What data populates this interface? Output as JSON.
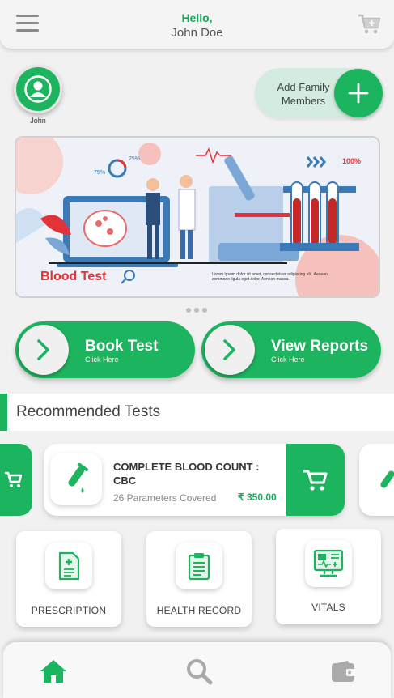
{
  "header": {
    "greeting": "Hello,",
    "user_name": "John Doe"
  },
  "profile": {
    "name": "John"
  },
  "add_family": {
    "label": "Add Family Members"
  },
  "banner": {
    "title": "Blood Test",
    "percent": "100%",
    "p25": "25%",
    "p75": "75%",
    "body": "Lorem ipsum dolor sit amet, consectetuer adipiscing elit. Aenean commodo ligula eget dolor. Aenean massa."
  },
  "actions": {
    "book": {
      "label": "Book Test",
      "sub": "Click Here"
    },
    "reports": {
      "label": "View Reports",
      "sub": "Click Here"
    }
  },
  "recommended": {
    "title": "Recommended Tests",
    "tests": [
      {
        "name": "COMPLETE BLOOD COUNT : CBC",
        "params": "26 Parameters Covered",
        "price": "₹ 350.00"
      }
    ]
  },
  "features": [
    {
      "label": "PRESCRIPTION",
      "icon": "prescription-icon"
    },
    {
      "label": "HEALTH RECORD",
      "icon": "clipboard-icon"
    },
    {
      "label": "VITALS",
      "icon": "vitals-monitor-icon"
    }
  ],
  "bottom_nav": [
    {
      "icon": "home-icon",
      "active": true
    },
    {
      "icon": "search-icon",
      "active": false
    },
    {
      "icon": "wallet-icon",
      "active": false
    }
  ],
  "colors": {
    "primary": "#1db45f",
    "accent_text": "#1aa85a",
    "light_green": "#d4ece0",
    "banner_red": "#e2333a"
  }
}
